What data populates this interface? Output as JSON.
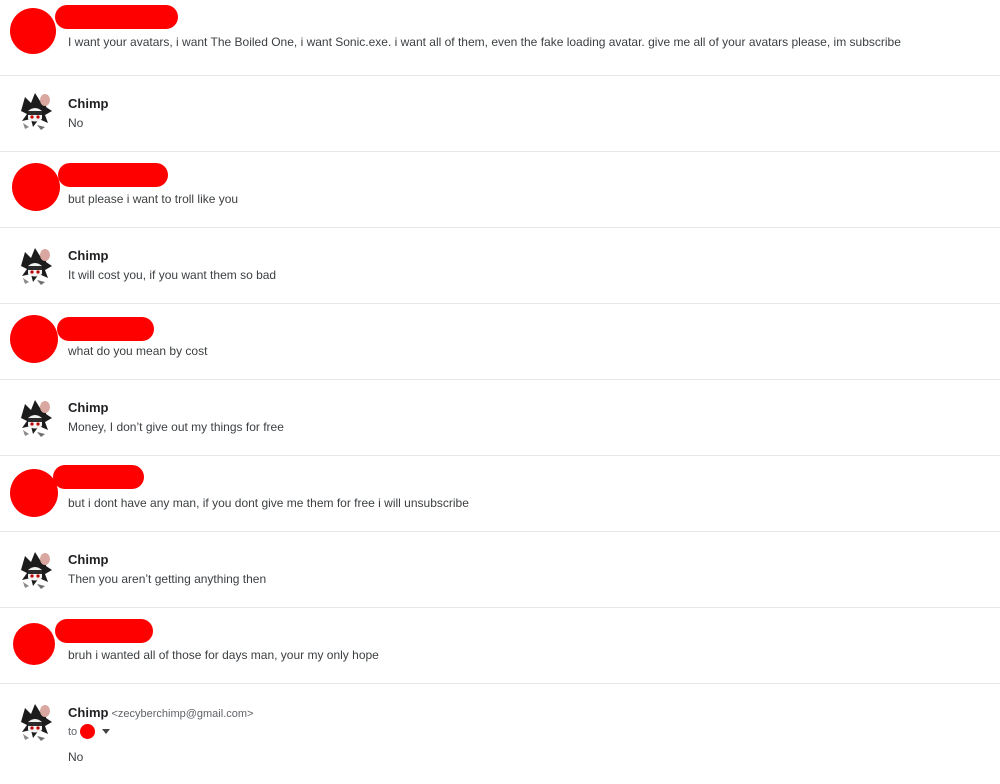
{
  "messages": [
    {
      "from": "redacted",
      "text": "I want your avatars, i want The Boiled One, i want Sonic.exe. i want all of them, even the fake loading avatar. give me all of your avatars please, im subscribe"
    },
    {
      "from": "Chimp",
      "text": "No"
    },
    {
      "from": "redacted",
      "text": "but please i want to troll like you"
    },
    {
      "from": "Chimp",
      "text": "It will cost you, if you want them so bad"
    },
    {
      "from": "redacted",
      "text": "what do you mean by cost"
    },
    {
      "from": "Chimp",
      "text": "Money, I don’t give out my things for free"
    },
    {
      "from": "redacted",
      "text": "but i dont have any man, if you dont give me them for free i will unsubscribe"
    },
    {
      "from": "Chimp",
      "text": "Then you aren’t getting anything then"
    },
    {
      "from": "redacted",
      "text": "bruh i wanted all of those for days man, your my only hope"
    },
    {
      "from": "Chimp",
      "email": "<zecyberchimp@gmail.com>",
      "to_label": "to",
      "text": "No"
    }
  ],
  "colors": {
    "redaction": "#ff0000",
    "divider": "#e6e6e6"
  },
  "icons": {
    "chimp_avatar": "chimp-avatar-icon",
    "recipient_menu": "chevron-down-icon"
  }
}
